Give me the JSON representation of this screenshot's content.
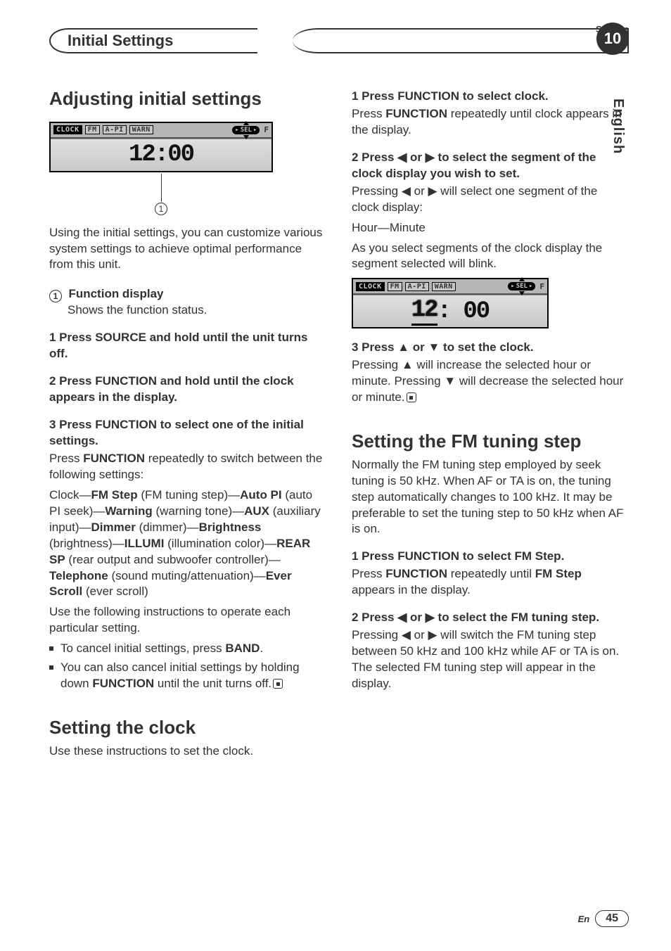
{
  "header": {
    "section_label": "Section",
    "section_title": "Initial Settings",
    "section_number": "10",
    "language": "English"
  },
  "left": {
    "h1": "Adjusting initial settings",
    "lcd": {
      "tags": [
        "CLOCK",
        "FM",
        "A-PI",
        "WARN"
      ],
      "f": "F",
      "sel": "SEL",
      "time": "12:00",
      "caption_num": "1"
    },
    "intro": "Using the initial settings, you can customize various system settings to achieve optimal performance from this unit.",
    "callout_num": "1",
    "callout_title": "Function display",
    "callout_sub": "Shows the function status.",
    "step1": "1    Press SOURCE and hold until the unit turns off.",
    "step2": "2    Press FUNCTION and hold until the clock appears in the display.",
    "step3": "3    Press FUNCTION to select one of the initial settings.",
    "step3_p1_a": "Press ",
    "step3_p1_b": "FUNCTION",
    "step3_p1_c": " repeatedly to switch between the following settings:",
    "settings_html": "Clock—<b>FM Step</b> (FM tuning step)—<b>Auto PI</b> (auto PI seek)—<b>Warning</b> (warning tone)—<b>AUX</b> (auxiliary input)—<b>Dimmer</b> (dimmer)—<b>Brightness</b> (brightness)—<b>ILLUMI</b> (illumination color)—<b>REAR SP</b> (rear output and subwoofer controller)—<b>Telephone</b> (sound muting/attenuation)—<b>Ever Scroll</b> (ever scroll)",
    "step3_p2": "Use the following instructions to operate each particular setting.",
    "bullet1_a": "To cancel initial settings, press ",
    "bullet1_b": "BAND",
    "bullet1_c": ".",
    "bullet2_a": "You can also cancel initial settings by holding down ",
    "bullet2_b": "FUNCTION",
    "bullet2_c": " until the unit turns off.",
    "h2_clock": "Setting the clock",
    "clock_intro": "Use these instructions to set the clock."
  },
  "right": {
    "s1": "1    Press FUNCTION to select clock.",
    "s1_p_a": "Press ",
    "s1_p_b": "FUNCTION",
    "s1_p_c": " repeatedly until clock appears in the display.",
    "s2": "2    Press ◀ or ▶ to select the segment of the clock display you wish to set.",
    "s2_p1": "Pressing ◀ or ▶ will select one segment of the clock display:",
    "s2_p2": "Hour—Minute",
    "s2_p3": "As you select segments of the clock display the segment selected will blink.",
    "lcd2": {
      "tags": [
        "CLOCK",
        "FM",
        "A-PI",
        "WARN"
      ],
      "f": "F",
      "sel": "SEL",
      "time_hr": "12",
      "time_rest": ": 00"
    },
    "s3": "3    Press ▲ or ▼ to set the clock.",
    "s3_p": "Pressing ▲ will increase the selected hour or minute. Pressing ▼ will decrease the selected hour or minute.",
    "h2_fm": "Setting the FM tuning step",
    "fm_intro": "Normally the FM tuning step employed by seek tuning is 50 kHz. When AF or TA is on, the tuning step automatically changes to 100 kHz. It may be preferable to set the tuning step to 50 kHz when AF is on.",
    "f1": "1    Press FUNCTION to select FM Step.",
    "f1_p_a": "Press ",
    "f1_p_b": "FUNCTION",
    "f1_p_c": " repeatedly until ",
    "f1_p_d": "FM Step",
    "f1_p_e": " appears in the display.",
    "f2": "2    Press ◀ or ▶ to select the FM tuning step.",
    "f2_p": "Pressing ◀ or ▶ will switch the FM tuning step between 50 kHz and 100 kHz while AF or TA is on. The selected FM tuning step will appear in the display."
  },
  "footer": {
    "lang": "En",
    "page": "45"
  }
}
